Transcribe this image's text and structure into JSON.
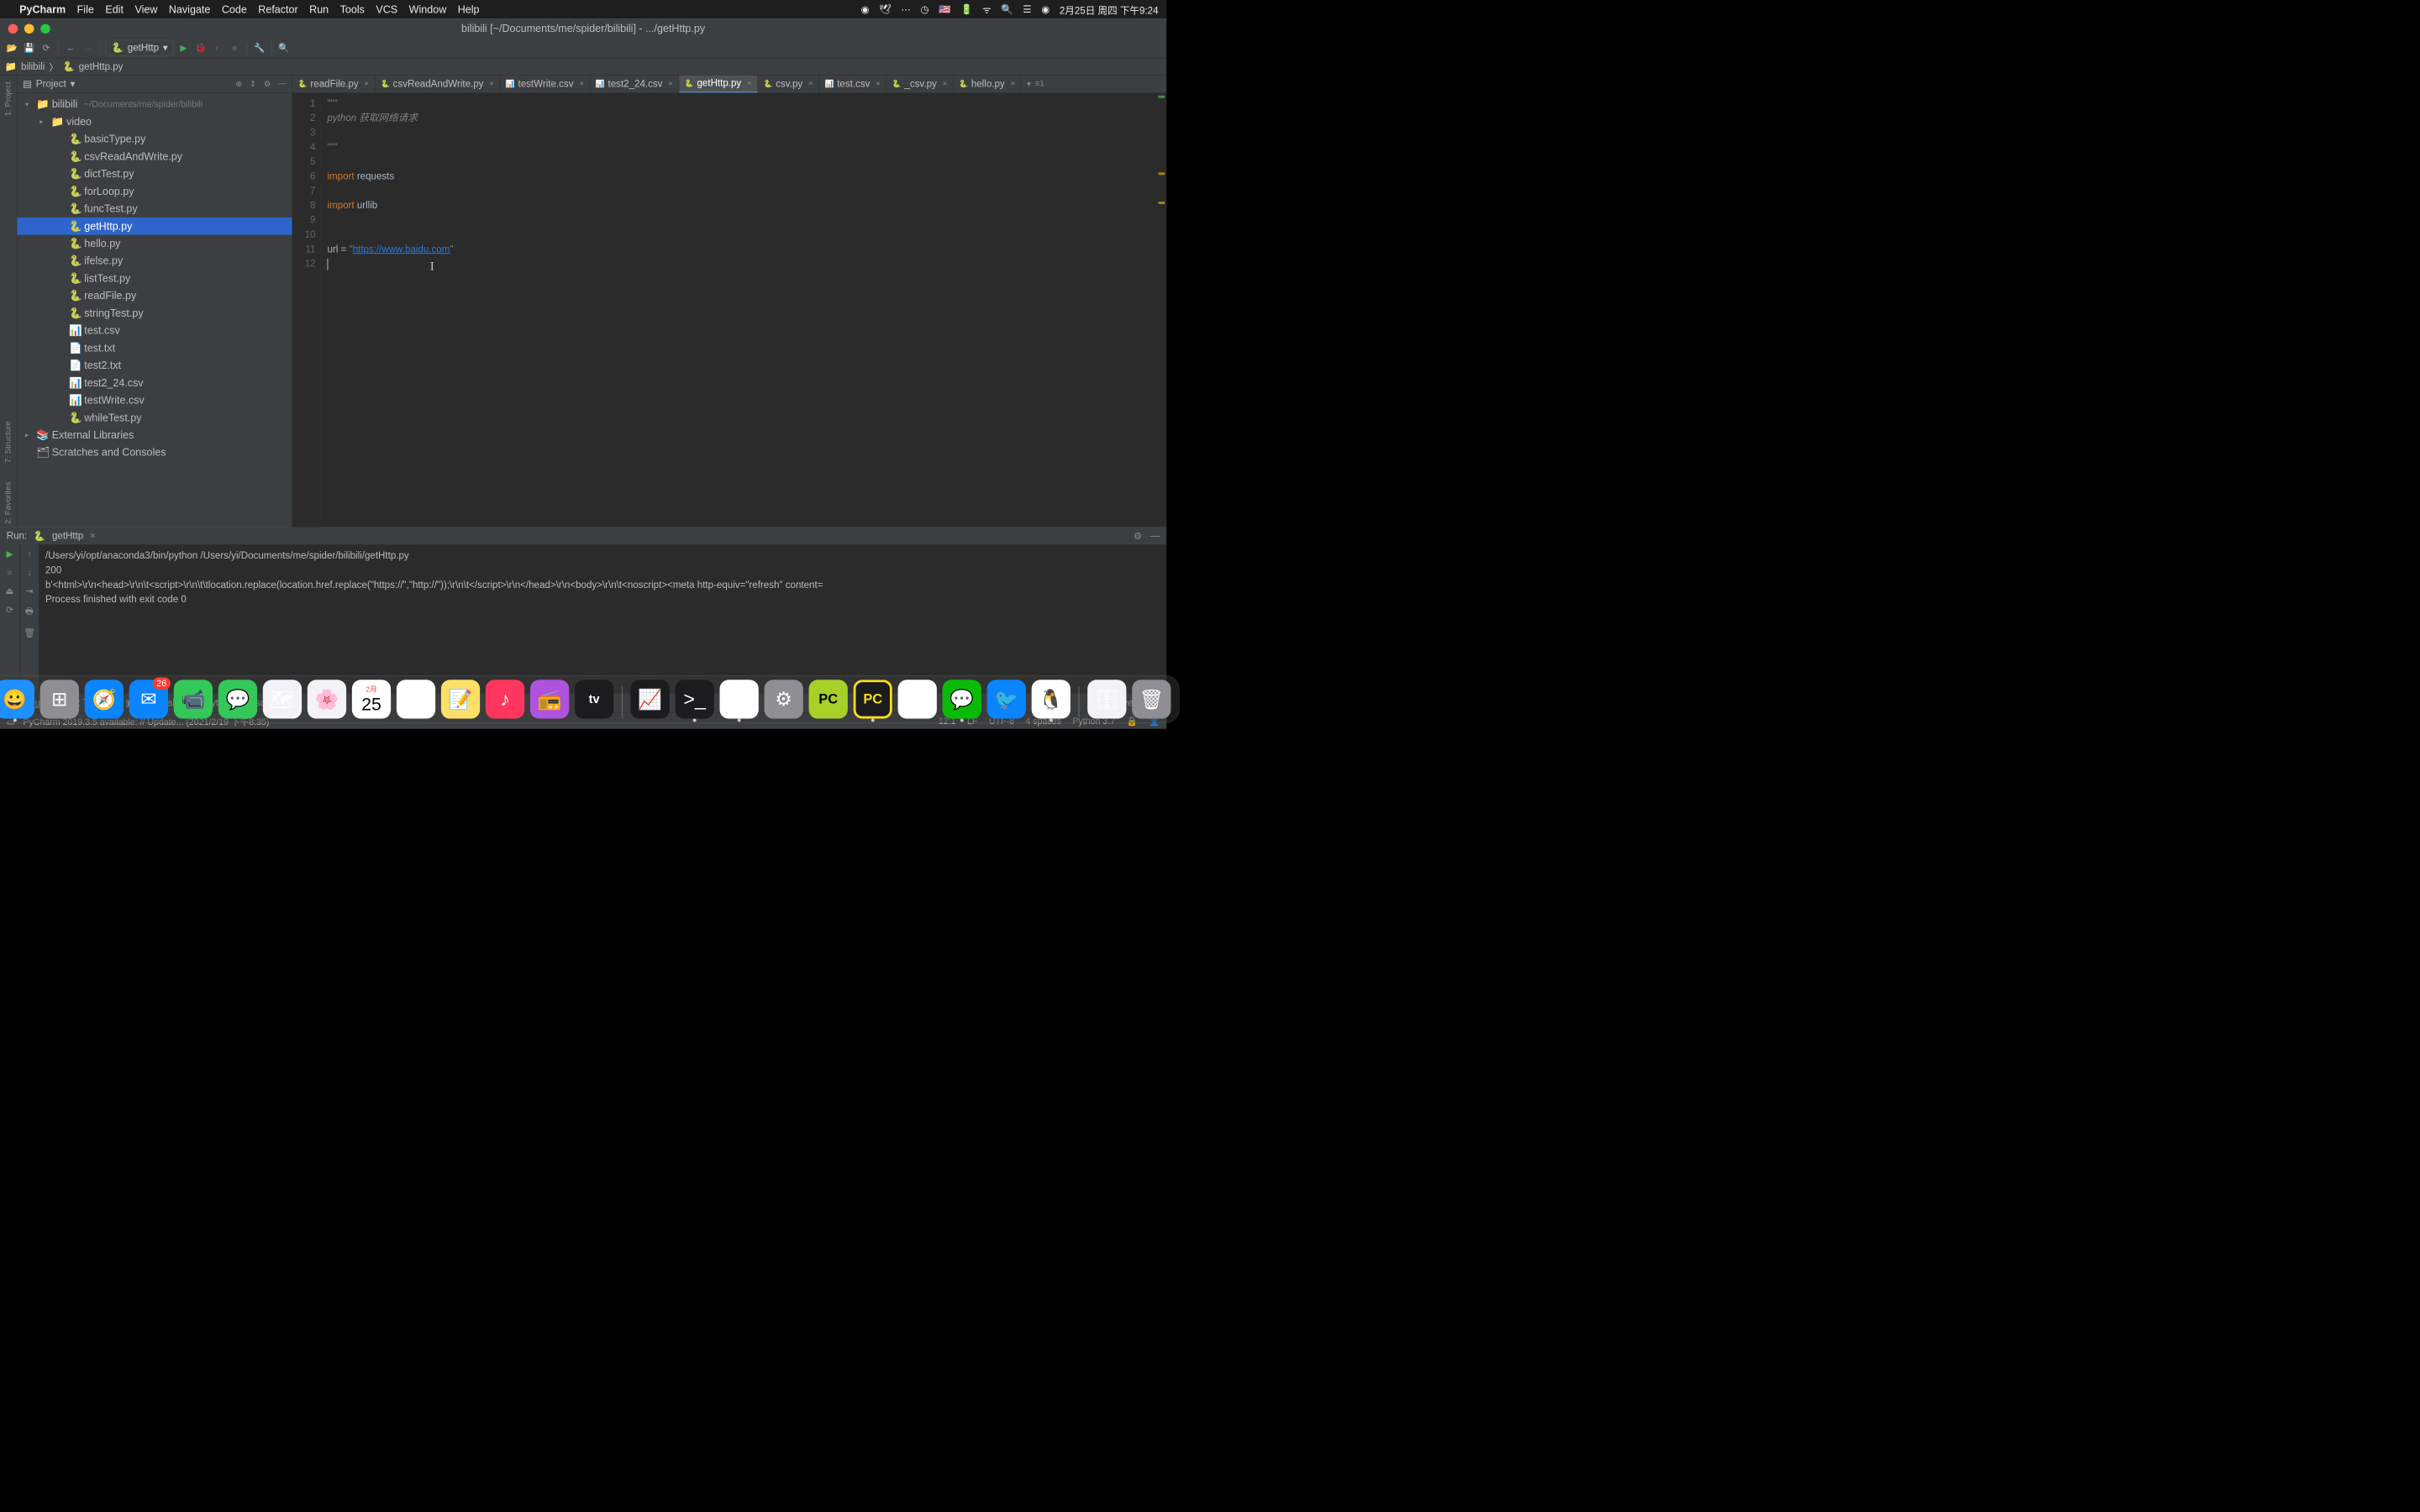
{
  "menubar": {
    "app": "PyCharm",
    "items": [
      "File",
      "Edit",
      "View",
      "Navigate",
      "Code",
      "Refactor",
      "Run",
      "Tools",
      "VCS",
      "Window",
      "Help"
    ],
    "clock": "2月25日 周四 下午9:24"
  },
  "window": {
    "title": "bilibili [~/Documents/me/spider/bilibili] - .../getHttp.py"
  },
  "runconfig": {
    "name": "getHttp"
  },
  "breadcrumb": {
    "root": "bilibili",
    "file": "getHttp.py"
  },
  "project": {
    "label": "Project",
    "root": {
      "name": "bilibili",
      "path": "~/Documents/me/spider/bilibili"
    },
    "folders": [
      "video"
    ],
    "files": [
      "basicType.py",
      "csvReadAndWrite.py",
      "dictTest.py",
      "forLoop.py",
      "funcTest.py",
      "getHttp.py",
      "hello.py",
      "ifelse.py",
      "listTest.py",
      "readFile.py",
      "stringTest.py",
      "test.csv",
      "test.txt",
      "test2.txt",
      "test2_24.csv",
      "testWrite.csv",
      "whileTest.py"
    ],
    "selected": "getHttp.py",
    "external": "External Libraries",
    "scratches": "Scratches and Consoles"
  },
  "tabs": [
    "readFile.py",
    "csvReadAndWrite.py",
    "testWrite.csv",
    "test2_24.csv",
    "getHttp.py",
    "csv.py",
    "test.csv",
    "_csv.py",
    "hello.py"
  ],
  "active_tab": "getHttp.py",
  "tabs_more": "≡1",
  "code": {
    "lines": [
      "1",
      "2",
      "3",
      "4",
      "5",
      "6",
      "7",
      "8",
      "9",
      "10",
      "11",
      "12"
    ],
    "l1": "\"\"\"",
    "l2a": "python ",
    "l2b": "获取网络请求",
    "l4": "\"\"\"",
    "l6": "import requests",
    "l8": "import urllib",
    "l11_pre": "url = ",
    "l11_q": "\"",
    "l11_url": "https://www.baidu.com",
    "l11_q2": "\""
  },
  "run": {
    "label": "Run:",
    "name": "getHttp",
    "out1": "/Users/yi/opt/anaconda3/bin/python /Users/yi/Documents/me/spider/bilibili/getHttp.py",
    "out2": "200",
    "out3": "b'<html>\\r\\n<head>\\r\\n\\t<script>\\r\\n\\t\\tlocation.replace(location.href.replace(\"https://\",\"http://\"));\\r\\n\\t</script>\\r\\n</head>\\r\\n<body>\\r\\n\\t<noscript><meta http-equiv=\"refresh\" content=",
    "out4": "",
    "out5": "Process finished with exit code 0"
  },
  "bottom": {
    "run": "4: Run",
    "todo": "6: TODO",
    "terminal": "Terminal",
    "pyconsole": "Python Console",
    "eventlog": "Event Log"
  },
  "status": {
    "update": "PyCharm 2019.3.5 available: // Update... (2021/2/19 下午8:35)",
    "pos": "12:1",
    "lf": "LF",
    "enc": "UTF-8",
    "indent": "4 spaces",
    "interp": "Python 3.7"
  },
  "dock": {
    "items": [
      {
        "name": "finder",
        "color": "#1e90ff",
        "glyph": "😀",
        "indic": true
      },
      {
        "name": "launchpad",
        "color": "#8e8e93",
        "glyph": "⊞"
      },
      {
        "name": "safari",
        "color": "#0a84ff",
        "glyph": "🧭"
      },
      {
        "name": "mail",
        "color": "#0a84ff",
        "glyph": "✉",
        "badge": "26"
      },
      {
        "name": "facetime",
        "color": "#34c759",
        "glyph": "📹"
      },
      {
        "name": "messages",
        "color": "#34c759",
        "glyph": "💬"
      },
      {
        "name": "maps",
        "color": "#f2f2f7",
        "glyph": "🗺"
      },
      {
        "name": "photos",
        "color": "#f2f2f7",
        "glyph": "🌸"
      },
      {
        "name": "calendar",
        "color": "#ffffff",
        "glyph": "25",
        "text": true,
        "label": "2月"
      },
      {
        "name": "reminders",
        "color": "#ffffff",
        "glyph": "☑"
      },
      {
        "name": "notes",
        "color": "#ffe066",
        "glyph": "📝"
      },
      {
        "name": "music",
        "color": "#ff375f",
        "glyph": "♪"
      },
      {
        "name": "podcasts",
        "color": "#af52de",
        "glyph": "📻"
      },
      {
        "name": "tv",
        "color": "#1c1c1e",
        "glyph": "tv"
      }
    ],
    "items2": [
      {
        "name": "activity",
        "color": "#1c1c1e",
        "glyph": "📈"
      },
      {
        "name": "terminal",
        "color": "#1c1c1e",
        "glyph": ">_",
        "indic": true
      },
      {
        "name": "chrome",
        "color": "#ffffff",
        "glyph": "◎",
        "indic": true
      },
      {
        "name": "settings",
        "color": "#8e8e93",
        "glyph": "⚙"
      },
      {
        "name": "pycharm-ce",
        "color": "#a7d129",
        "glyph": "PC"
      },
      {
        "name": "pycharm",
        "color": "#1c1c1e",
        "glyph": "PC",
        "indic": true,
        "hl": "#f7df1e"
      },
      {
        "name": "wps",
        "color": "#ffffff",
        "glyph": "W"
      },
      {
        "name": "wechat",
        "color": "#09bb07",
        "glyph": "💬",
        "indic": true
      },
      {
        "name": "thunderbird",
        "color": "#0a84ff",
        "glyph": "🐦"
      },
      {
        "name": "qq",
        "color": "#ffffff",
        "glyph": "🐧",
        "indic": true
      }
    ],
    "items3": [
      {
        "name": "zip",
        "color": "#f2f2f7",
        "glyph": "🗄"
      },
      {
        "name": "trash",
        "color": "#8e8e93",
        "glyph": "🗑"
      }
    ]
  }
}
